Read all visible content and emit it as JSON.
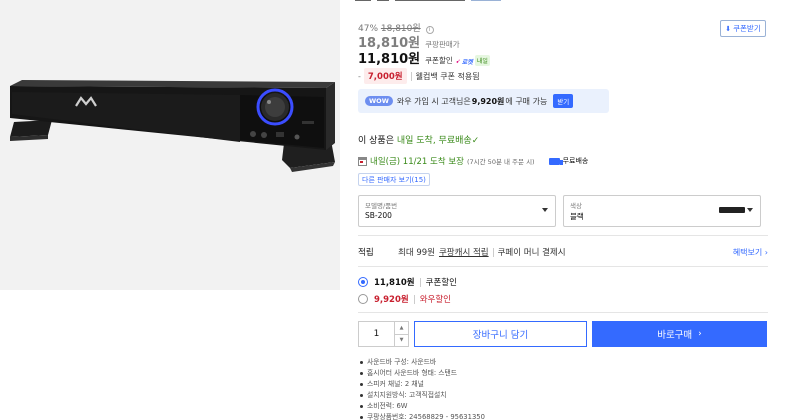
{
  "product": {
    "discount_rate": "47%",
    "original_price": "18,810원",
    "coupon_download": "쿠폰받기",
    "price1": {
      "amount": "18,810원",
      "label": "쿠팡판매가"
    },
    "price2": {
      "amount": "11,810원",
      "label": "쿠폰할인",
      "rocket": "로켓",
      "badge": "내일"
    },
    "wow_price": {
      "amount": "7,000원",
      "desc": "웰컴백 쿠폰 적용됨"
    },
    "wow_banner": {
      "badge": "WOW",
      "text_prefix": "와우 가입 시 고객님은",
      "amount": "9,920원",
      "text_suffix": "에 구매 가능",
      "button": "받기"
    },
    "free_shipping": {
      "prefix": "이 상품은",
      "highlight": "내일 도착, 무료배송",
      "check": "✓"
    },
    "delivery": {
      "highlight": "내일(금) 11/21 도착 보장",
      "note": "(7시간 50분 내 주문 시)",
      "shipping": "무료배송"
    },
    "other_sellers": "다른 판매자 보기(15)",
    "options": [
      {
        "label": "모델명/품번",
        "value": "SB-200"
      },
      {
        "label": "색상",
        "value": "블랙"
      }
    ],
    "reward": {
      "label": "적립",
      "text1": "최대 99원",
      "text2": "쿠팡캐시 적립",
      "text3": "쿠페이 머니 결제시",
      "more": "혜택보기 ›"
    },
    "price_choices": [
      {
        "price": "11,810원",
        "label": "쿠폰할인",
        "selected": true
      },
      {
        "price": "9,920원",
        "label": "와우할인",
        "selected": false
      }
    ],
    "quantity": "1",
    "cart_button": "장바구니 담기",
    "buy_button": "바로구매",
    "buy_chevron": "›",
    "specs": [
      "사운드바 구성: 사운드바",
      "홈시어터 사운드바 형태: 스탠드",
      "스피커 채널: 2 채널",
      "설치지원방식: 고객직접설치",
      "소비전력: 6W",
      "쿠팡상품번호: 24568829 - 95631350"
    ]
  },
  "colors": {
    "accent": "#346aff",
    "wow_red": "#c8202f",
    "green": "#3a8a1a"
  }
}
